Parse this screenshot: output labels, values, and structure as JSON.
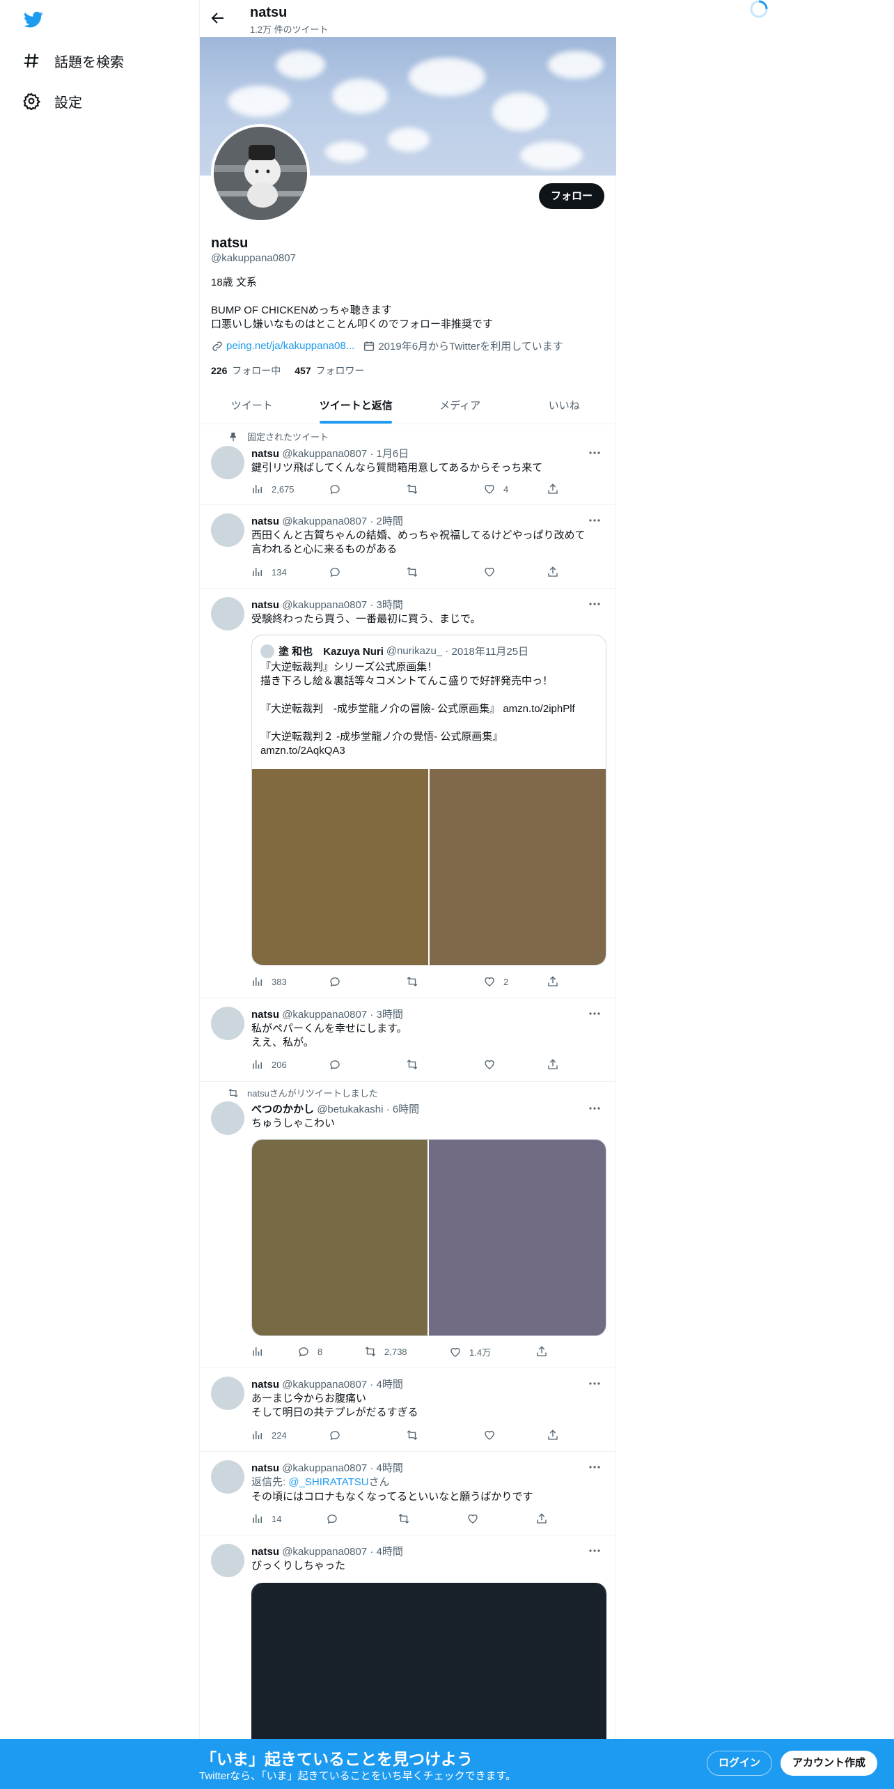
{
  "nav": {
    "explore_label": "話題を検索",
    "settings_label": "設定"
  },
  "header": {
    "name": "natsu",
    "tweet_count": "1.2万 件のツイート"
  },
  "profile": {
    "follow_label": "フォロー",
    "name": "natsu",
    "handle": "@kakuppana0807",
    "bio": "18歳 文系\n\nBUMP OF CHICKENめっちゃ聴きます\n口悪いし嫌いなものはとことん叩くのでフォロー非推奨です",
    "link": "peing.net/ja/kakuppana08...",
    "joined": "2019年6月からTwitterを利用しています",
    "following_count": "226",
    "following_label": "フォロー中",
    "followers_count": "457",
    "followers_label": "フォロワー"
  },
  "tabs": [
    "ツイート",
    "ツイートと返信",
    "メディア",
    "いいね"
  ],
  "tweets": [
    {
      "social": "固定されたツイート",
      "name": "natsu",
      "handle": "@kakuppana0807",
      "time": "1月6日",
      "text": "鍵引リツ飛ばしてくんなら質問箱用意してあるからそっち来て",
      "views": "2,675",
      "replies": "",
      "retweets": "",
      "likes": "4"
    },
    {
      "name": "natsu",
      "handle": "@kakuppana0807",
      "time": "2時間",
      "text": "西田くんと古賀ちゃんの結婚、めっちゃ祝福してるけどやっぱり改めて\n言われると心に来るものがある",
      "views": "134",
      "replies": "",
      "retweets": "",
      "likes": ""
    },
    {
      "name": "natsu",
      "handle": "@kakuppana0807",
      "time": "3時間",
      "text": "受験終わったら買う、一番最初に買う、まじで。",
      "quote": {
        "name": "塗 和也　Kazuya Nuri",
        "handle": "@nurikazu_",
        "time": "2018年11月25日",
        "text": "『大逆転裁判』シリーズ公式原画集！\n描き下ろし絵＆裏話等々コメントてんこ盛りで好評発売中っ！\n\n『大逆転裁判　-成歩堂龍ノ介の冒險- 公式原画集』 amzn.to/2iphPlf\n\n『大逆転裁判２ -成歩堂龍ノ介の覺悟- 公式原画集』\namzn.to/2AqkQA3",
        "colors": [
          "#826a40",
          "#80694a"
        ]
      },
      "views": "383",
      "replies": "",
      "retweets": "",
      "likes": "2"
    },
    {
      "name": "natsu",
      "handle": "@kakuppana0807",
      "time": "3時間",
      "text": "私がペパーくんを幸せにします。\nええ、私が。",
      "views": "206",
      "replies": "",
      "retweets": "",
      "likes": ""
    },
    {
      "social": "natsuさんがリツイートしました",
      "name": "べつのかかし",
      "handle": "@betukakashi",
      "time": "6時間",
      "text": "ちゅうしゃこわい",
      "media_colors": [
        "#776a45",
        "#716b84"
      ],
      "views": "",
      "replies": "8",
      "retweets": "2,738",
      "likes": "1.4万"
    },
    {
      "name": "natsu",
      "handle": "@kakuppana0807",
      "time": "4時間",
      "text": "あーまじ今からお腹痛い\nそして明日の共テプレがだるすぎる",
      "views": "224",
      "replies": "",
      "retweets": "",
      "likes": ""
    },
    {
      "name": "natsu",
      "handle": "@kakuppana0807",
      "time": "4時間",
      "reply_prefix": "返信先: ",
      "reply_to": "@_SHIRATATSU",
      "reply_suffix": "さん",
      "text": "その頃にはコロナもなくなってるといいなと願うばかりです",
      "views": "14",
      "replies": "",
      "retweets": "",
      "likes": ""
    },
    {
      "name": "natsu",
      "handle": "@kakuppana0807",
      "time": "4時間",
      "text": "びっくりしちゃった",
      "media_colors": [
        "#18202a"
      ]
    }
  ],
  "bottom": {
    "title": "「いま」起きていることを見つけよう",
    "subtitle": "Twitterなら、「いま」起きていることをいち早くチェックできます。",
    "login_label": "ログイン",
    "signup_label": "アカウント作成"
  },
  "colors": {
    "accent": "#1d9bf0",
    "text": "#0f1419",
    "muted": "#536471",
    "border": "#eff3f4"
  }
}
